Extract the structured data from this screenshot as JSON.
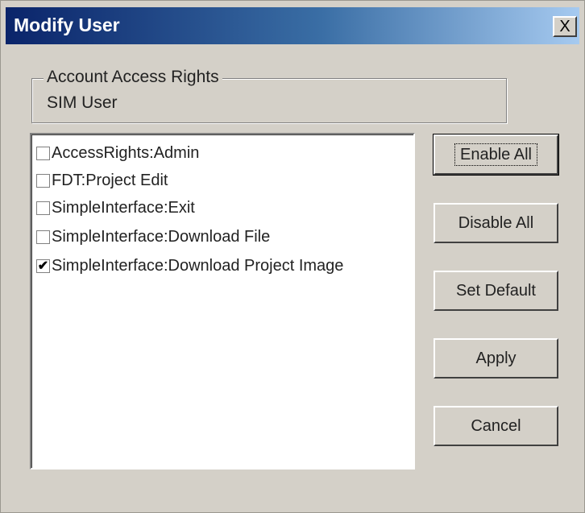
{
  "window": {
    "title": "Modify User",
    "close_label": "X"
  },
  "group": {
    "legend": "Account Access Rights",
    "value": "SIM User"
  },
  "permissions": [
    {
      "label": "AccessRights:Admin",
      "checked": false
    },
    {
      "label": "FDT:Project Edit",
      "checked": false
    },
    {
      "label": "SimpleInterface:Exit",
      "checked": false
    },
    {
      "label": "SimpleInterface:Download File",
      "checked": false
    },
    {
      "label": "SimpleInterface:Download Project Image",
      "checked": true
    }
  ],
  "check_mark": "✔",
  "buttons": {
    "enable_all": "Enable All",
    "disable_all": "Disable All",
    "set_default": "Set Default",
    "apply": "Apply",
    "cancel": "Cancel"
  }
}
